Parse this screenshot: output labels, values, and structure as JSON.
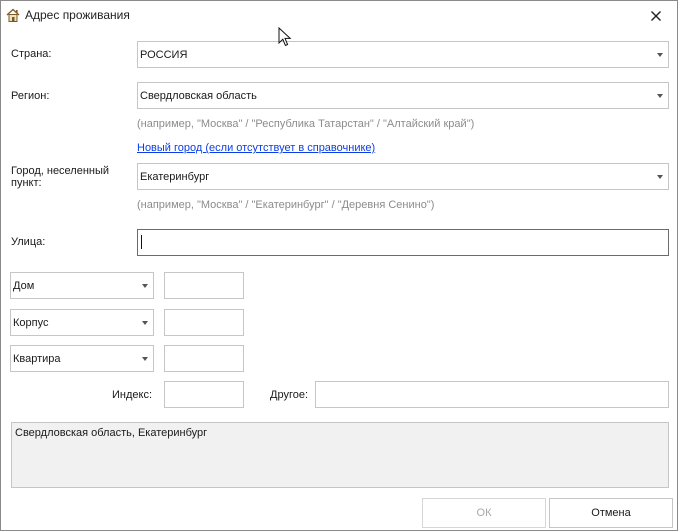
{
  "window": {
    "title": "Адрес проживания"
  },
  "labels": {
    "country": "Страна:",
    "region": "Регион:",
    "city": "Город, неселенный пункт:",
    "street": "Улица:",
    "index": "Индекс:",
    "other": "Другое:"
  },
  "country": {
    "value": "РОССИЯ"
  },
  "region": {
    "value": "Свердловская область",
    "hint": "(например, \"Москва\" / \"Республика Татарстан\" / \"Алтайский край\")"
  },
  "new_city_link": "Новый город (если отсутствует в справочнике)",
  "city": {
    "value": "Екатеринбург",
    "hint": "(например, \"Москва\" / \"Екатеринбург\" / \"Деревня Сенино\")"
  },
  "street": {
    "value": ""
  },
  "house_types": [
    {
      "label": "Дом",
      "value": ""
    },
    {
      "label": "Корпус",
      "value": ""
    },
    {
      "label": "Квартира",
      "value": ""
    }
  ],
  "index": {
    "value": ""
  },
  "other": {
    "value": ""
  },
  "summary": "Свердловская область, Екатеринбург",
  "buttons": {
    "ok": "ОК",
    "cancel": "Отмена"
  }
}
